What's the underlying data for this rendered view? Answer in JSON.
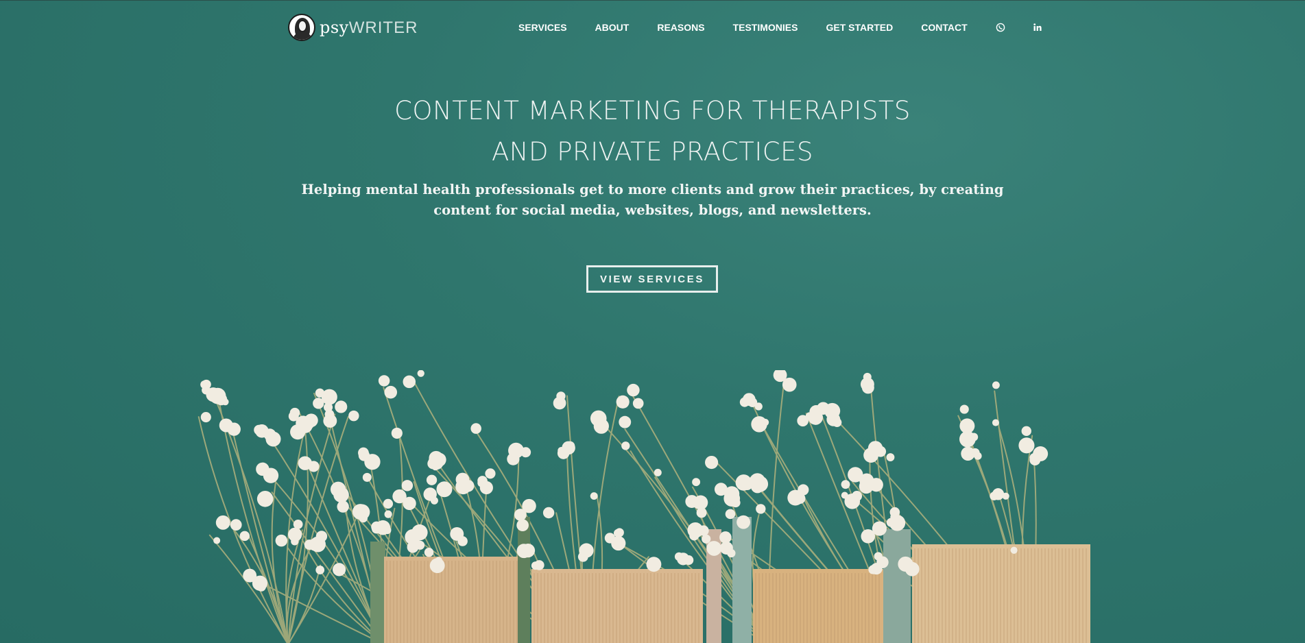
{
  "logo": {
    "psy": "psy",
    "writer": "WRITER"
  },
  "nav": {
    "items": [
      {
        "label": "SERVICES"
      },
      {
        "label": "ABOUT"
      },
      {
        "label": "REASONS"
      },
      {
        "label": "TESTIMONIES"
      },
      {
        "label": "GET STARTED"
      },
      {
        "label": "CONTACT"
      }
    ],
    "icons": [
      "whatsapp-icon",
      "linkedin-icon"
    ]
  },
  "hero": {
    "title_line1": "CONTENT MARKETING FOR THERAPISTS",
    "title_line2": "AND PRIVATE PRACTICES",
    "subtitle": "Helping mental health professionals get to more clients and grow their practices, by creating content for social media, websites, blogs, and newsletters.",
    "cta_label": "VIEW SERVICES"
  },
  "colors": {
    "background": "#2f766d",
    "text": "#ffffff",
    "flower": "#f1ece1",
    "book_pages": "#d9b890"
  }
}
